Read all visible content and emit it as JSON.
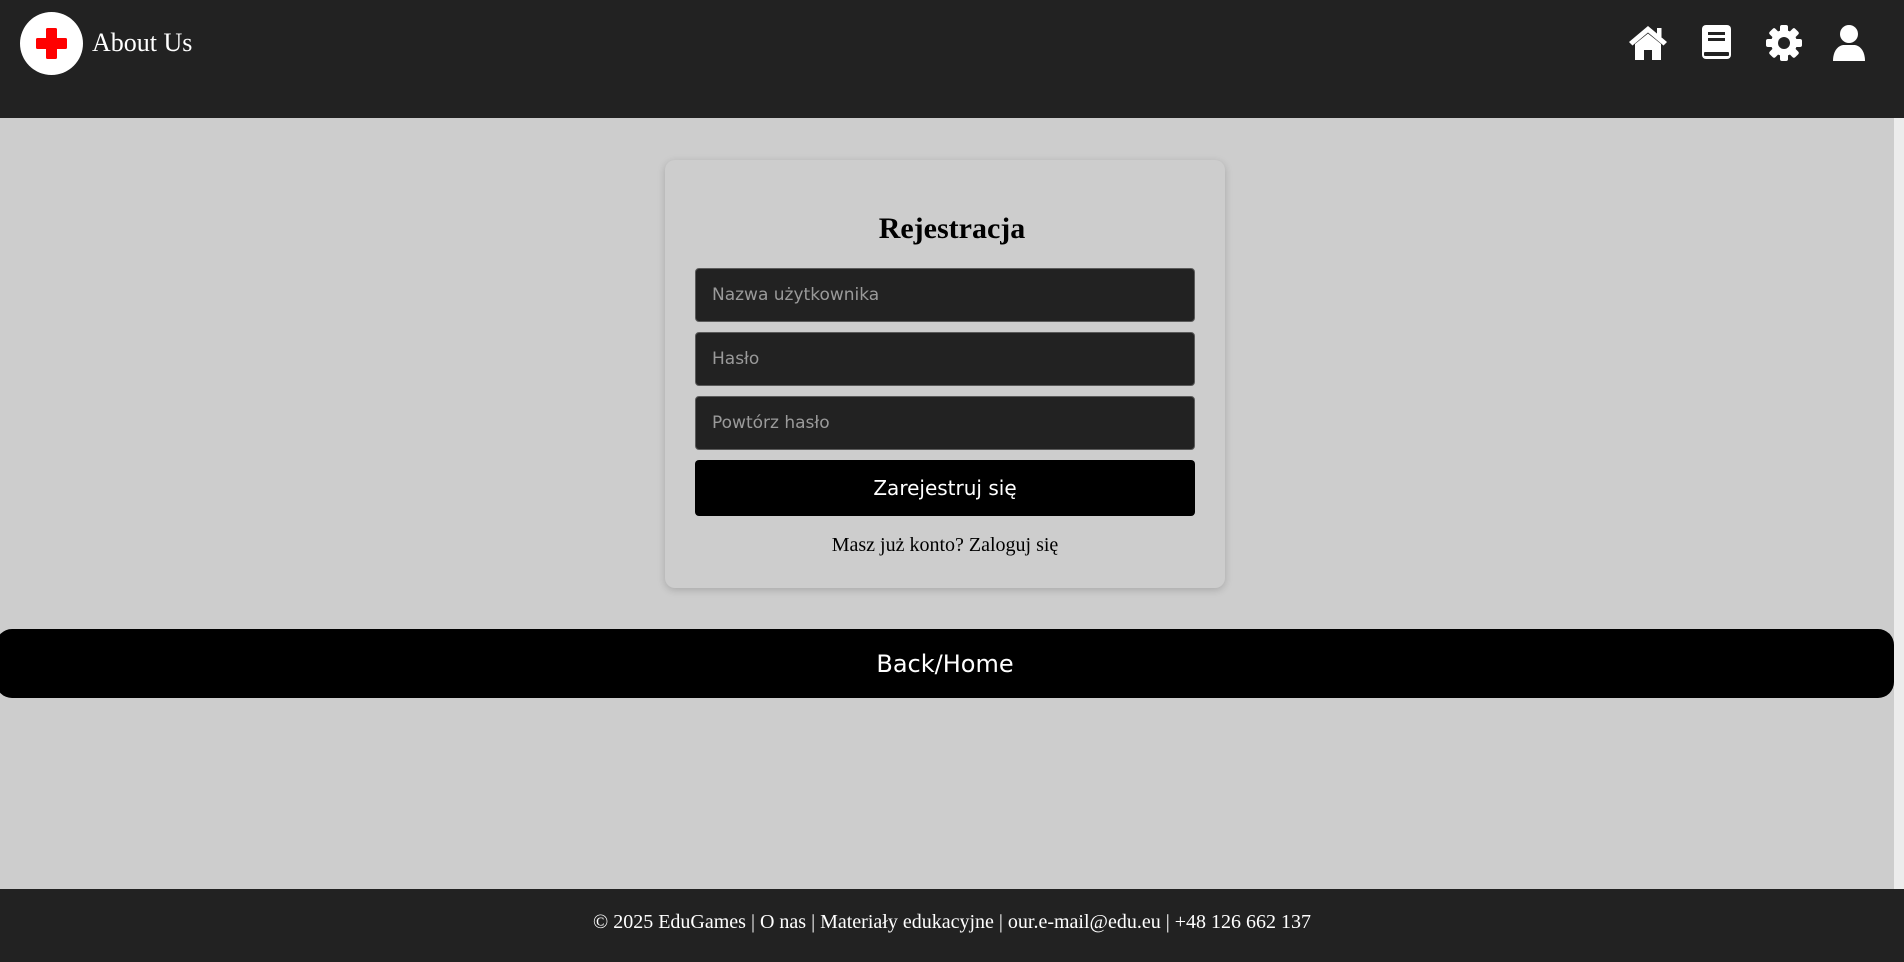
{
  "header": {
    "title": "About Us",
    "nav_icons": [
      "home-icon",
      "book-icon",
      "gear-icon",
      "user-icon"
    ]
  },
  "colors": {
    "header_bg": "#222222",
    "page_bg": "#cdcdcd",
    "accent_red": "#ff0000",
    "button_bg": "#000000"
  },
  "form": {
    "title": "Rejestracja",
    "username_placeholder": "Nazwa użytkownika",
    "password_placeholder": "Hasło",
    "repeat_password_placeholder": "Powtórz hasło",
    "submit_label": "Zarejestruj się",
    "login_prompt": "Masz już konto?",
    "login_link": "Zaloguj się"
  },
  "back_button": {
    "label": "Back/Home"
  },
  "footer": {
    "text": "© 2025 EduGames | O nas | Materiały edukacyjne | our.e-mail@edu.eu | +48 126 662 137"
  }
}
